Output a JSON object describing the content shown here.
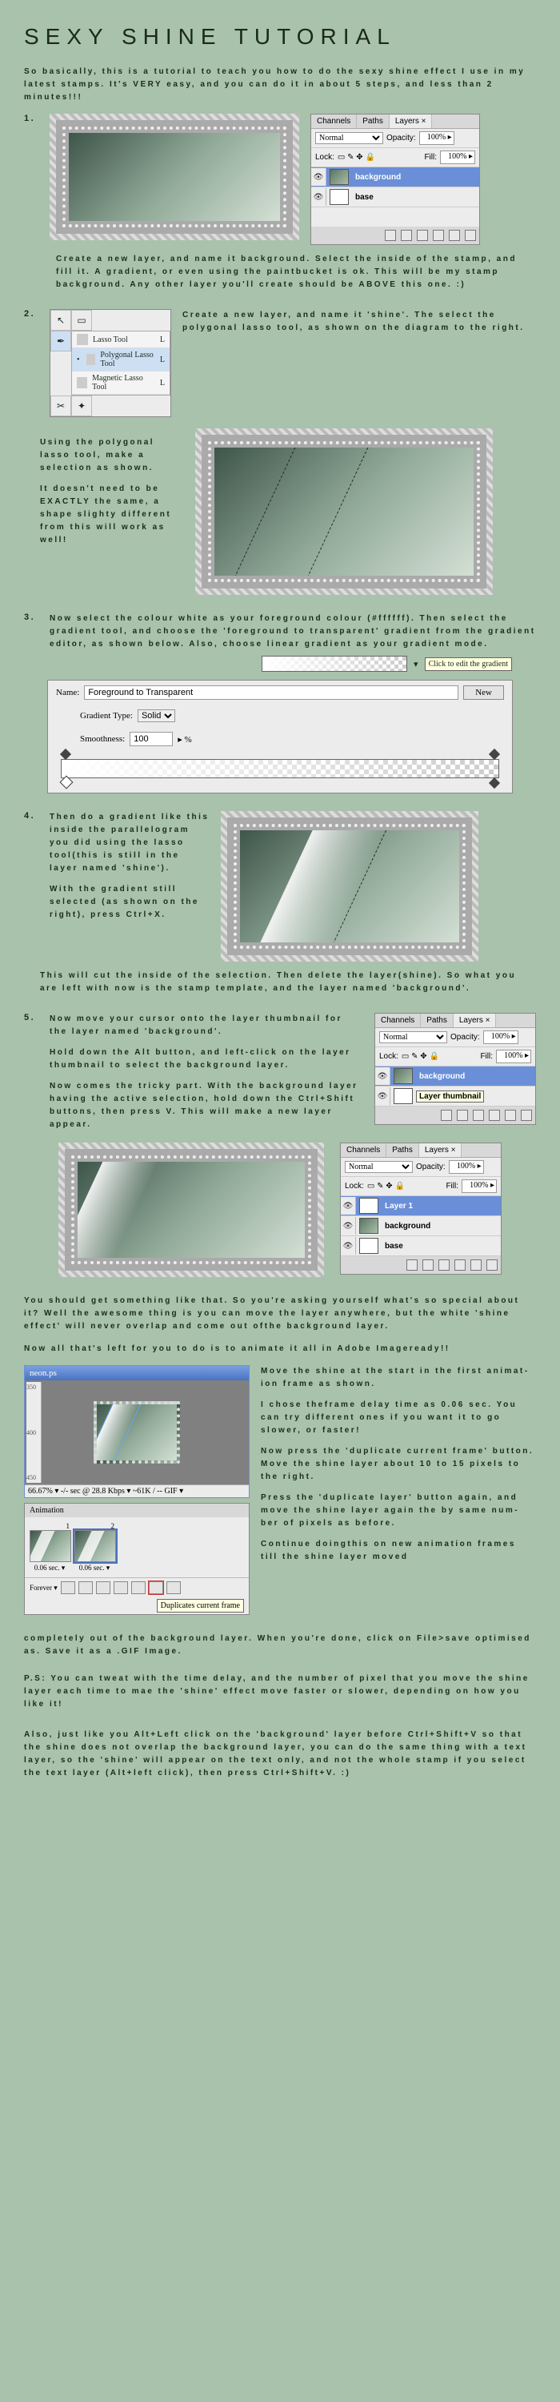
{
  "title": "SEXY SHINE TUTORIAL",
  "intro": "So basically, this is a tutorial to teach you how to do the sexy shine effect I use in my latest stamps. It's VERY easy, and you can do it in about 5 steps, and less than 2 minutes!!!",
  "steps": {
    "s1": {
      "num": "1.",
      "text": "Create a new layer, and name it background. Select the inside of the stamp, and fill it. A gradient, or even using the paintbucket is ok. This will be my stamp background. Any other layer you'll create should be ABOVE this one. :)"
    },
    "s2": {
      "num": "2.",
      "right": "Create a new layer, and name it 'shine'. The select the polygonal lasso tool, as shown on the diagram to the right.",
      "left1": "Using the polygonal lasso tool, make a selection as shown.",
      "left2": "It doesn't need to be EXACTLY the same, a shape slighty different from this will work as well!"
    },
    "s3": {
      "num": "3.",
      "text": "Now select the colour white as your foreground colour (#ffffff). Then select the gradient tool, and choose the 'foreground to transparent' gradient from the gradient editor, as shown below. Also, choose linear gradient as your gradient mode."
    },
    "s4": {
      "num": "4.",
      "p1": "Then do a gradient like this inside the parallelogram you did using the lasso tool(this is still in the layer named 'shine').",
      "p2": "With the gradient still selected (as shown on the right), press Ctrl+X.",
      "p3": "This will cut the inside of the selection. Then delete the layer(shine). So what you are left with now is the stamp template, and the layer named 'background'."
    },
    "s5": {
      "num": "5.",
      "p1": "Now move your cursor onto the layer thumbnail for the layer named 'background'.",
      "p2": "Hold down the Alt button, and left-click on the layer thumbnail to select the background layer.",
      "p3": "Now comes the tricky part. With the background layer having the active selection, hold down the Ctrl+Shift buttons, then press V. This will make a new layer appear."
    }
  },
  "after5_p1": "You should get something like that. So you're asking yourself what's so special about it? Well the awesome thing is you can move the layer anywhere, but the white 'shine effect' will never overlap and come out ofthe background layer.",
  "after5_p2": "Now all that's left for you to do is to animate it all in Adobe Imageready!!",
  "anim": {
    "p1": "Move the shine at the start in the first animat-ion frame as shown.",
    "p2": "I chose theframe delay time as 0.06 sec. You can try different ones if you want it to go slower, or faster!",
    "p3": "Now press the 'duplicate current frame' button. Move the shine layer about 10 to 15 pixels to the right.",
    "p4": "Press the 'duplicate layer' button again, and move the shine layer again the by same num-ber of pixels as before.",
    "p5": "Continue doingthis on new animation frames till the shine layer moved"
  },
  "tail1": "completely out of the background layer. When you're done, click on File>save optimised as. Save it as a .GIF Image.",
  "tail2": "P.S: You can tweat with the time delay, and the number of pixel that you move the shine layer each time to mae the 'shine' effect move faster or slower, depending on how you like it!",
  "tail3": "Also, just like you Alt+Left click on the 'background' layer before Ctrl+Shift+V so that the shine does not overlap the background layer, you can do the same thing with a text layer, so the 'shine' will appear on the text only, and not the whole stamp if you select the text layer (Alt+left click), then press Ctrl+Shift+V. :)",
  "layers": {
    "tabs": [
      "Channels",
      "Paths",
      "Layers ×"
    ],
    "mode": "Normal",
    "opacity_label": "Opacity:",
    "opacity": "100% ▸",
    "lock_label": "Lock:",
    "fill_label": "Fill:",
    "fill": "100% ▸",
    "items1": [
      "background",
      "base"
    ],
    "items5a": [
      "background",
      "Layer thumbnail"
    ],
    "items5b": [
      "Layer 1",
      "background",
      "base"
    ]
  },
  "tools": {
    "opts": [
      {
        "label": "Lasso Tool",
        "key": "L"
      },
      {
        "label": "Polygonal Lasso Tool",
        "key": "L",
        "active": true
      },
      {
        "label": "Magnetic Lasso Tool",
        "key": "L"
      }
    ]
  },
  "grad": {
    "name_label": "Name:",
    "name": "Foreground to Transparent",
    "new": "New",
    "type_label": "Gradient Type:",
    "type": "Solid",
    "smooth_label": "Smoothness:",
    "smooth": "100",
    "pct": "▸ %",
    "tooltip": "Click to edit the gradient"
  },
  "ir": {
    "title": "neon.ps",
    "status": "66.67% ▾  -/- sec @ 28.8 Kbps ▾  ~61K / -- GIF ▾",
    "anim_title": "Animation",
    "delay": "0.06 sec. ▾",
    "loop": "Forever ▾",
    "dup_tip": "Duplicates current frame"
  }
}
